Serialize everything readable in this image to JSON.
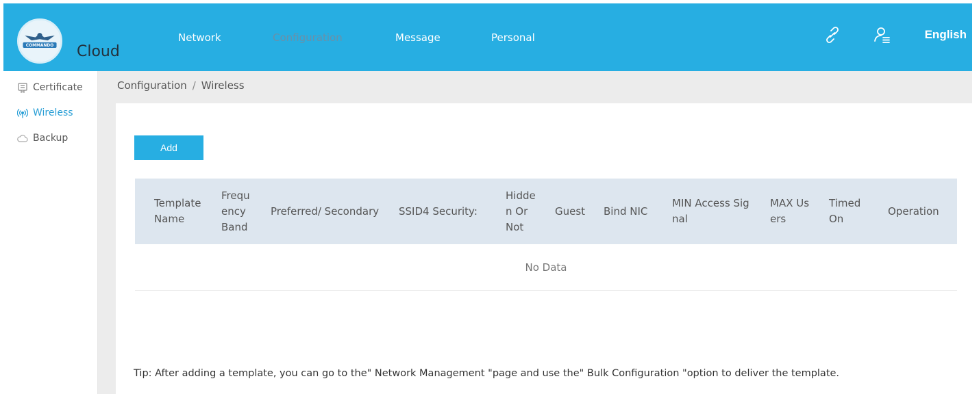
{
  "header": {
    "logo_badge": "COMMANDO",
    "logo_text": "Cloud",
    "nav": [
      {
        "label": "Network",
        "active": false
      },
      {
        "label": "Configuration",
        "active": true
      },
      {
        "label": "Message",
        "active": false
      },
      {
        "label": "Personal",
        "active": false
      }
    ],
    "icons": [
      "link-icon",
      "user-list-icon"
    ],
    "language": "English",
    "colors": {
      "bar": "#27aee2",
      "active_nav": "#6a90a8"
    }
  },
  "sidebar": {
    "items": [
      {
        "label": "Certificate",
        "icon": "certificate-icon",
        "active": false
      },
      {
        "label": "Wireless",
        "icon": "wireless-icon",
        "active": true
      },
      {
        "label": "Backup",
        "icon": "cloud-icon",
        "active": false
      }
    ]
  },
  "breadcrumb": {
    "parent": "Configuration",
    "separator": "/",
    "current": "Wireless"
  },
  "toolbar": {
    "add_label": "Add"
  },
  "table": {
    "columns": [
      [
        "Template",
        "Name"
      ],
      [
        "Frequ",
        "ency",
        "Band"
      ],
      [
        "Preferred/ Secondary"
      ],
      [
        "SSID4 Security:"
      ],
      [
        "Hidde",
        "n Or",
        "Not"
      ],
      [
        "Guest"
      ],
      [
        "Bind NIC"
      ],
      [
        "MIN Access Sig",
        "nal"
      ],
      [
        "MAX Us",
        "ers"
      ],
      [
        "Timed",
        "On"
      ],
      [
        "Operation"
      ]
    ],
    "empty_text": "No Data"
  },
  "tip": "Tip: After adding a template, you can go to the\" Network Management \"page and use the\" Bulk Configuration \"option to deliver the template."
}
